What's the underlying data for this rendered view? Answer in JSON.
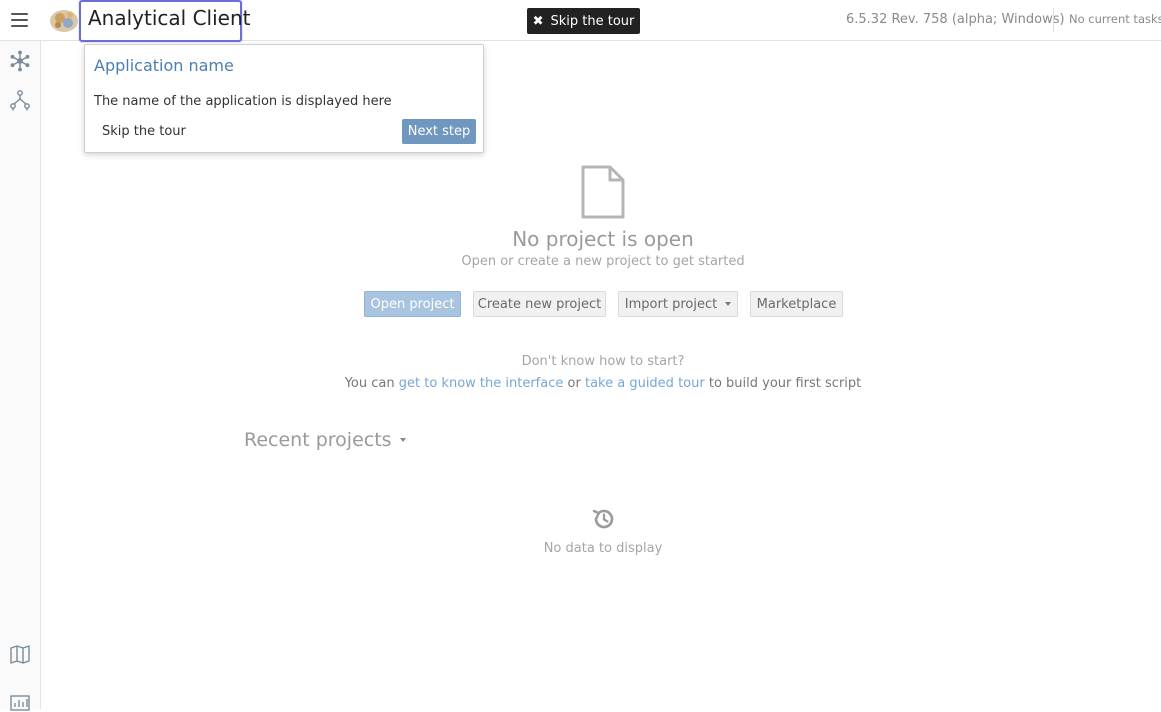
{
  "header": {
    "app_title": "Analytical Client",
    "skip_tour_label": "Skip the tour",
    "version": "6.5.32 Rev. 758 (alpha; Windows)",
    "tasks_status": "No current tasks"
  },
  "sidebar": {
    "icons": [
      "snowflake-icon",
      "network-icon",
      "map-icon",
      "chart-icon"
    ]
  },
  "tour": {
    "title": "Application name",
    "body": "The name of the application is displayed here",
    "skip_label": "Skip the tour",
    "next_label": "Next step"
  },
  "empty_state": {
    "title": "No project is open",
    "subtitle": "Open or create a new project to get started",
    "buttons": {
      "open": "Open project",
      "create": "Create new project",
      "import": "Import project",
      "marketplace": "Marketplace"
    },
    "help_question": "Don't know how to start?",
    "help_prefix": "You can",
    "help_link_interface": "get to know the interface",
    "help_or": "or",
    "help_link_tour": "take a guided tour",
    "help_suffix": "to build your first script"
  },
  "recent": {
    "title": "Recent projects",
    "empty": "No data to display"
  },
  "colors": {
    "accent": "#4a7fb0",
    "highlight_border": "#6a6fd6",
    "next_button": "#6f97bf",
    "open_button": "#a9c4df",
    "link": "#77a7d6"
  }
}
